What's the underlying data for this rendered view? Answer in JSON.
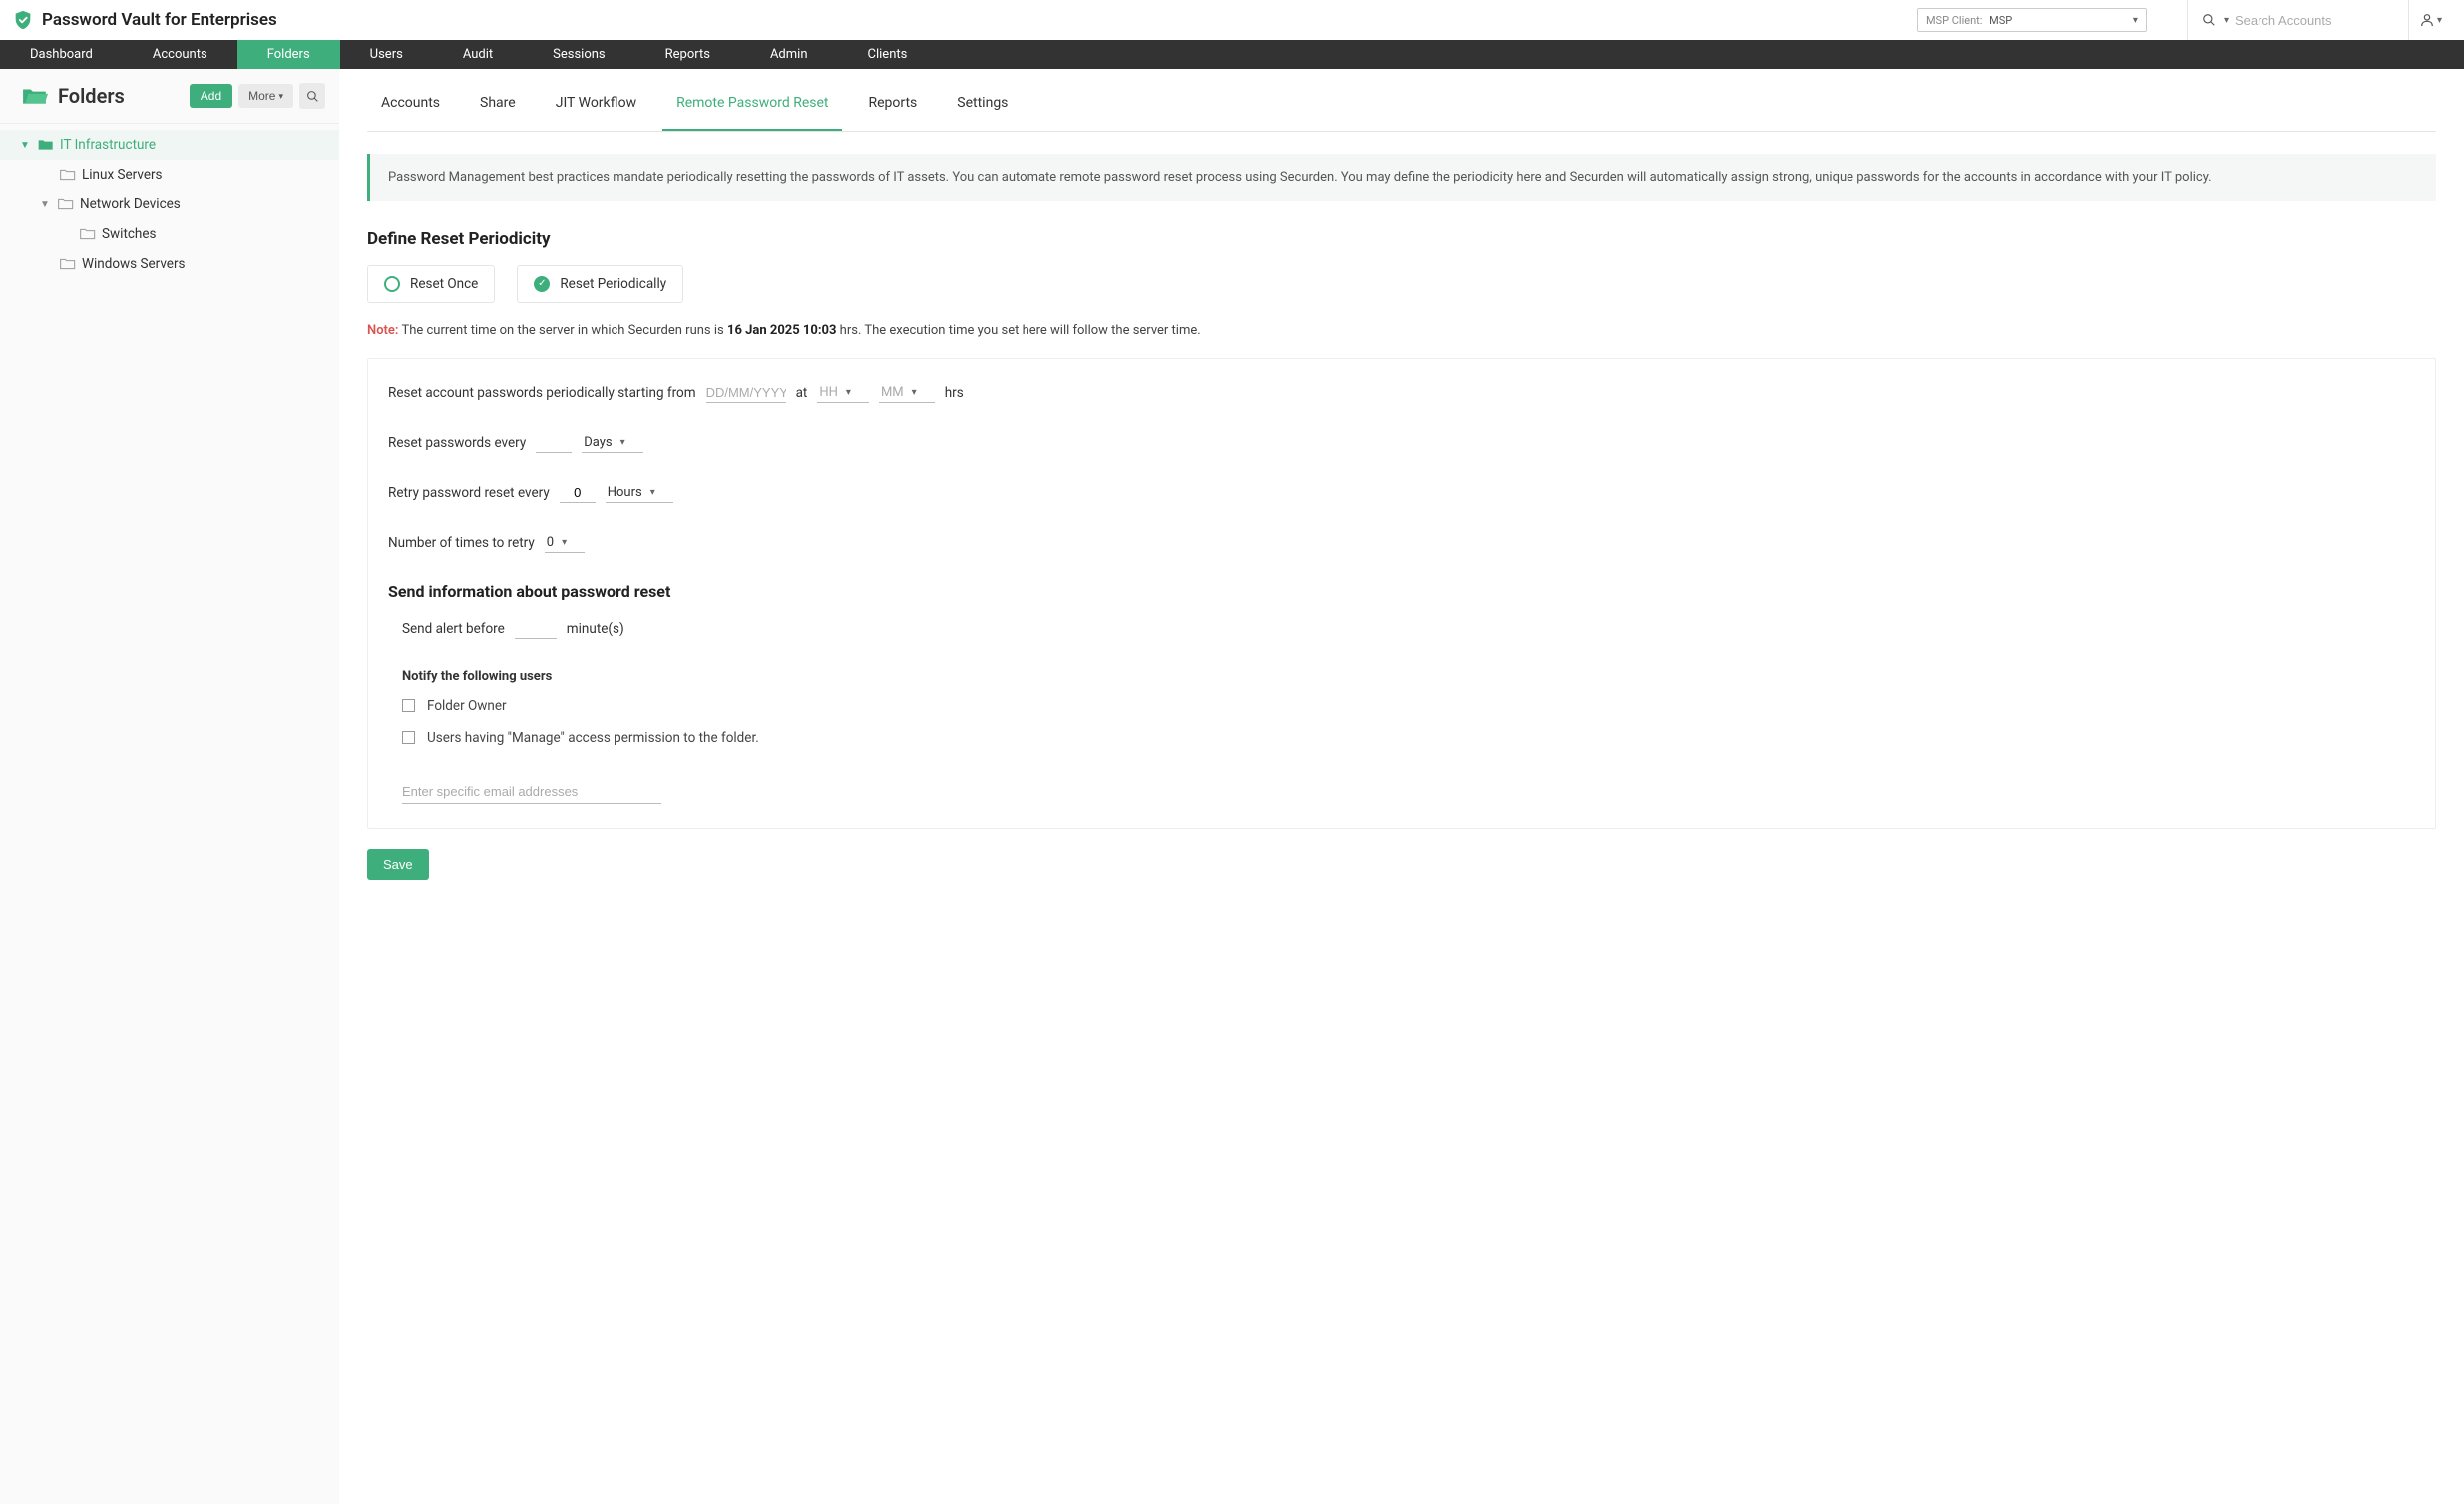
{
  "header": {
    "product_title": "Password Vault for Enterprises",
    "msp_client_prefix": "MSP Client:",
    "msp_client_value": "MSP",
    "search_placeholder": "Search Accounts"
  },
  "mainnav": {
    "items": [
      "Dashboard",
      "Accounts",
      "Folders",
      "Users",
      "Audit",
      "Sessions",
      "Reports",
      "Admin",
      "Clients"
    ],
    "active_index": 2
  },
  "sidebar": {
    "title": "Folders",
    "add_label": "Add",
    "more_label": "More",
    "tree": {
      "root": "IT Infrastructure",
      "children": [
        {
          "label": "Linux Servers"
        },
        {
          "label": "Network Devices",
          "expanded": true,
          "children": [
            {
              "label": "Switches"
            }
          ]
        },
        {
          "label": "Windows Servers"
        }
      ]
    }
  },
  "subtabs": {
    "items": [
      "Accounts",
      "Share",
      "JIT Workflow",
      "Remote Password Reset",
      "Reports",
      "Settings"
    ],
    "active_index": 3
  },
  "banner_text": "Password Management best practices mandate periodically resetting the passwords of IT assets. You can automate remote password reset process using Securden. You may define the periodicity here and Securden will automatically assign strong, unique passwords for the accounts in accordance with your IT policy.",
  "section_title": "Define Reset Periodicity",
  "radio": {
    "once": "Reset Once",
    "periodically": "Reset Periodically"
  },
  "note": {
    "label": "Note:",
    "prefix": "The current time on the server in which Securden runs is",
    "time": "16 Jan 2025 10:03",
    "suffix": "hrs. The execution time you set here will follow the server time."
  },
  "form": {
    "row1_label": "Reset account passwords periodically starting from",
    "date_placeholder": "DD/MM/YYYY",
    "at_label": "at",
    "hh_placeholder": "HH",
    "mm_placeholder": "MM",
    "hrs_label": "hrs",
    "row2_label": "Reset passwords every",
    "days_unit": "Days",
    "row3_label": "Retry password reset every",
    "retry_value": "0",
    "hours_unit": "Hours",
    "row4_label": "Number of times to retry",
    "retry_count": "0"
  },
  "notify": {
    "section_title": "Send information about password reset",
    "alert_before_label": "Send alert before",
    "minutes_label": "minute(s)",
    "notify_users_label": "Notify the following users",
    "folder_owner": "Folder Owner",
    "manage_users": "Users having \"Manage\" access permission to the folder.",
    "email_placeholder": "Enter specific email addresses"
  },
  "save_label": "Save"
}
